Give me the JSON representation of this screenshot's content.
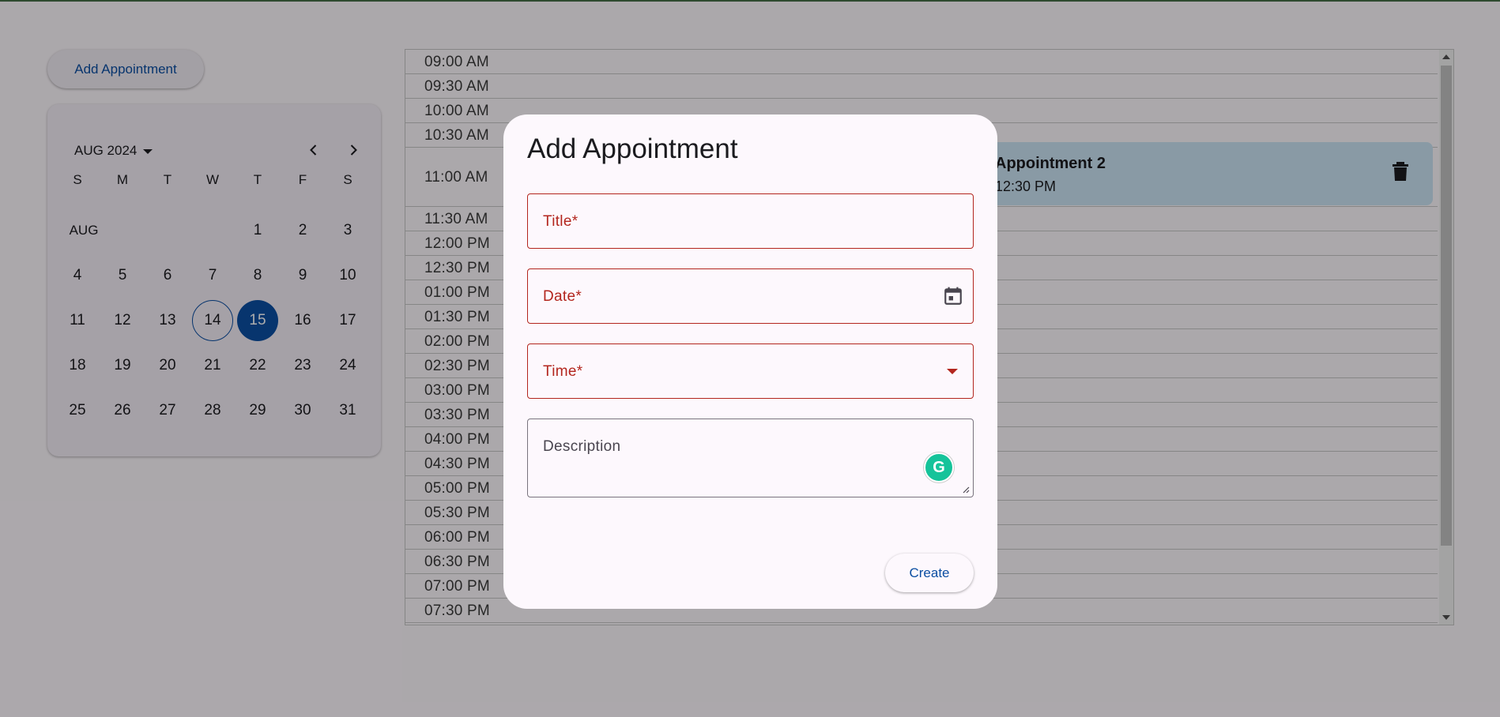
{
  "toolbar": {
    "add_label": "Add Appointment"
  },
  "calendar": {
    "month_label": "AUG 2024",
    "weekdays": [
      "S",
      "M",
      "T",
      "W",
      "T",
      "F",
      "S"
    ],
    "month_short": "AUG",
    "weeks": [
      [
        "",
        "",
        "",
        "",
        "1",
        "2",
        "3"
      ],
      [
        "4",
        "5",
        "6",
        "7",
        "8",
        "9",
        "10"
      ],
      [
        "11",
        "12",
        "13",
        "14",
        "15",
        "16",
        "17"
      ],
      [
        "18",
        "19",
        "20",
        "21",
        "22",
        "23",
        "24"
      ],
      [
        "25",
        "26",
        "27",
        "28",
        "29",
        "30",
        "31"
      ]
    ],
    "today": "14",
    "selected": "15"
  },
  "schedule": {
    "slots": [
      "09:00 AM",
      "09:30 AM",
      "10:00 AM",
      "10:30 AM",
      "11:00 AM",
      "11:30 AM",
      "12:00 PM",
      "12:30 PM",
      "01:00 PM",
      "01:30 PM",
      "02:00 PM",
      "02:30 PM",
      "03:00 PM",
      "03:30 PM",
      "04:00 PM",
      "04:30 PM",
      "05:00 PM",
      "05:30 PM",
      "06:00 PM",
      "06:30 PM",
      "07:00 PM",
      "07:30 PM"
    ],
    "appointment": {
      "title": "Appointment 2",
      "time": "12:30 PM"
    }
  },
  "dialog": {
    "title": "Add Appointment",
    "title_label": "Title*",
    "date_label": "Date*",
    "time_label": "Time*",
    "description_label": "Description",
    "grammarly_letter": "G",
    "create_label": "Create"
  },
  "colors": {
    "accent": "#0b4ea2",
    "error": "#b3261e",
    "appointment_bg": "#cbe4f4",
    "scrim": "rgba(0,0,0,0.32)"
  },
  "icons": {
    "calendar": "calendar-icon",
    "delete": "trash-icon",
    "dropdown": "chevron-down-icon",
    "prev": "chevron-left-icon",
    "next": "chevron-right-icon"
  }
}
